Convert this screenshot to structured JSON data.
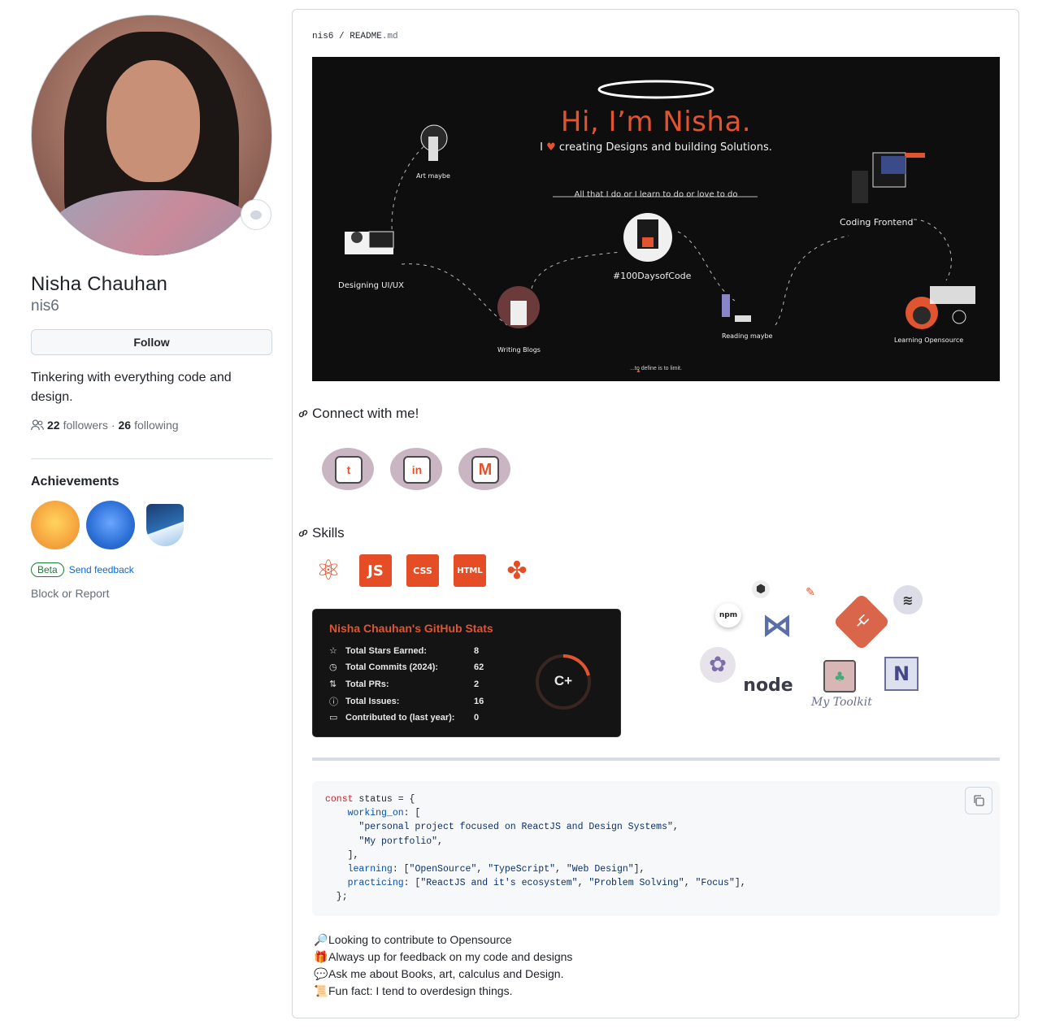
{
  "profile": {
    "name": "Nisha Chauhan",
    "login": "nis6",
    "follow_label": "Follow",
    "bio": "Tinkering with everything code and design.",
    "followers_count": "22",
    "followers_label": "followers",
    "separator": "·",
    "following_count": "26",
    "following_label": "following"
  },
  "achievements": {
    "title": "Achievements",
    "beta_label": "Beta",
    "feedback_label": "Send feedback",
    "block_label": "Block or Report"
  },
  "readme": {
    "path_user": "nis6",
    "path_sep": "/",
    "path_file": "README",
    "path_ext": ".md",
    "banner": {
      "title": "Hi, I’m Nisha.",
      "subtitle_pre": "I",
      "subtitle_post": "creating Designs and building Solutions.",
      "tagline": "All that I do or I learn to do or love to do",
      "labels": {
        "art": "Art maybe",
        "designing": "Designing UI/UX",
        "writing": "Writing Blogs",
        "days": "#100DaysofCode",
        "reading": "Reading maybe",
        "frontend": "Coding Frontend",
        "opensource": "Learning Opensource"
      },
      "footer": "...to define is to limit."
    },
    "connect_heading": "Connect with me!",
    "skills_heading": "Skills",
    "skill_icons": [
      "JS",
      "CSS",
      "HTML"
    ],
    "toolkit_label": "My Toolkit",
    "stats": {
      "title": "Nisha Chauhan's GitHub Stats",
      "rank": "C+",
      "rows": [
        {
          "label": "Total Stars Earned:",
          "value": "8"
        },
        {
          "label": "Total Commits (2024):",
          "value": "62"
        },
        {
          "label": "Total PRs:",
          "value": "2"
        },
        {
          "label": "Total Issues:",
          "value": "16"
        },
        {
          "label": "Contributed to (last year):",
          "value": "0"
        }
      ]
    },
    "notes": [
      "Looking to contribute to Opensource",
      "Always up for feedback on my code and designs",
      "Ask me about Books, art, calculus and Design.",
      "Fun fact: I tend to overdesign things."
    ]
  },
  "colors": {
    "accent_orange": "#e0552f",
    "link_blue": "#0969da",
    "beta_green": "#1a7f37"
  }
}
